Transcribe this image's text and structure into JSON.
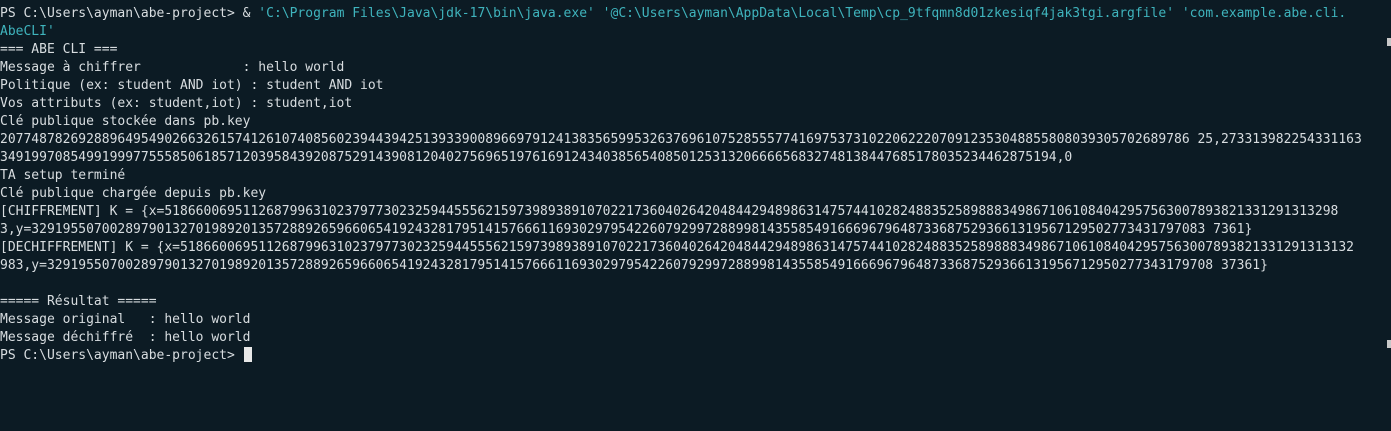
{
  "prompt": "PS C:\\Users\\ayman\\abe-project>",
  "command": {
    "operator": " & ",
    "arg1": "'C:\\Program Files\\Java\\jdk-17\\bin\\java.exe'",
    "arg2": "'@C:\\Users\\ayman\\AppData\\Local\\Temp\\cp_9tfqmn8d01zkesiqf4jak3tgi.argfile'",
    "arg3_part1": "'com.example.abe.cli.",
    "arg3_part2": "AbeCLI'"
  },
  "output": {
    "header": "=== ABE CLI ===",
    "message_line": "Message à chiffrer             : hello world",
    "policy_line": "Politique (ex: student AND iot) : student AND iot",
    "attrs_line": "Vos attributs (ex: student,iot) : student,iot",
    "pubkey_saved": "Clé publique stockée dans pb.key",
    "pubkey_val_1": "20774878269288964954902663261574126107408560239443942513933900896697912413835659953263769610752855577416975373102206222070912353048855808039305702689786 25,273313982254331163",
    "pubkey_val_2": "349199708549919997755585061857120395843920875291439081204027569651976169124340385654085012531320666656832748138447685178035234462875194,0",
    "ta_setup": "TA setup terminé",
    "pubkey_loaded": "Clé publique chargée depuis pb.key",
    "chiffrement_1": "[CHIFFREMENT] K = {x=518660069511268799631023797730232594455562159739893891070221736040264204844294898631475744102824883525898883498671061084042957563007893821331291313298",
    "chiffrement_2": "3,y=329195507002897901327019892013572889265966065419243281795141576661169302979542260792997288998143558549166696796487336875293661319567129502773431797083 7361}",
    "dechiffrement_1": "[DECHIFFREMENT] K = {x=518660069511268799631023797730232594455562159739893891070221736040264204844294898631475744102824883525898883498671061084042957563007893821331291313132",
    "dechiffrement_2": "983,y=32919550700289790132701989201357288926596606541924328179514157666116930297954226079299728899814355854916669679648733687529366131956712950277343179708 37361}",
    "blank": "",
    "result_header": "===== Résultat =====",
    "original": "Message original   : hello world",
    "decrypted": "Message déchiffré  : hello world",
    "final_prompt": "PS C:\\Users\\ayman\\abe-project>"
  },
  "colors": {
    "background": "#0c1b24",
    "text": "#d8dde0",
    "string": "#3fb4bd",
    "cursor": "#e8e8e8"
  }
}
